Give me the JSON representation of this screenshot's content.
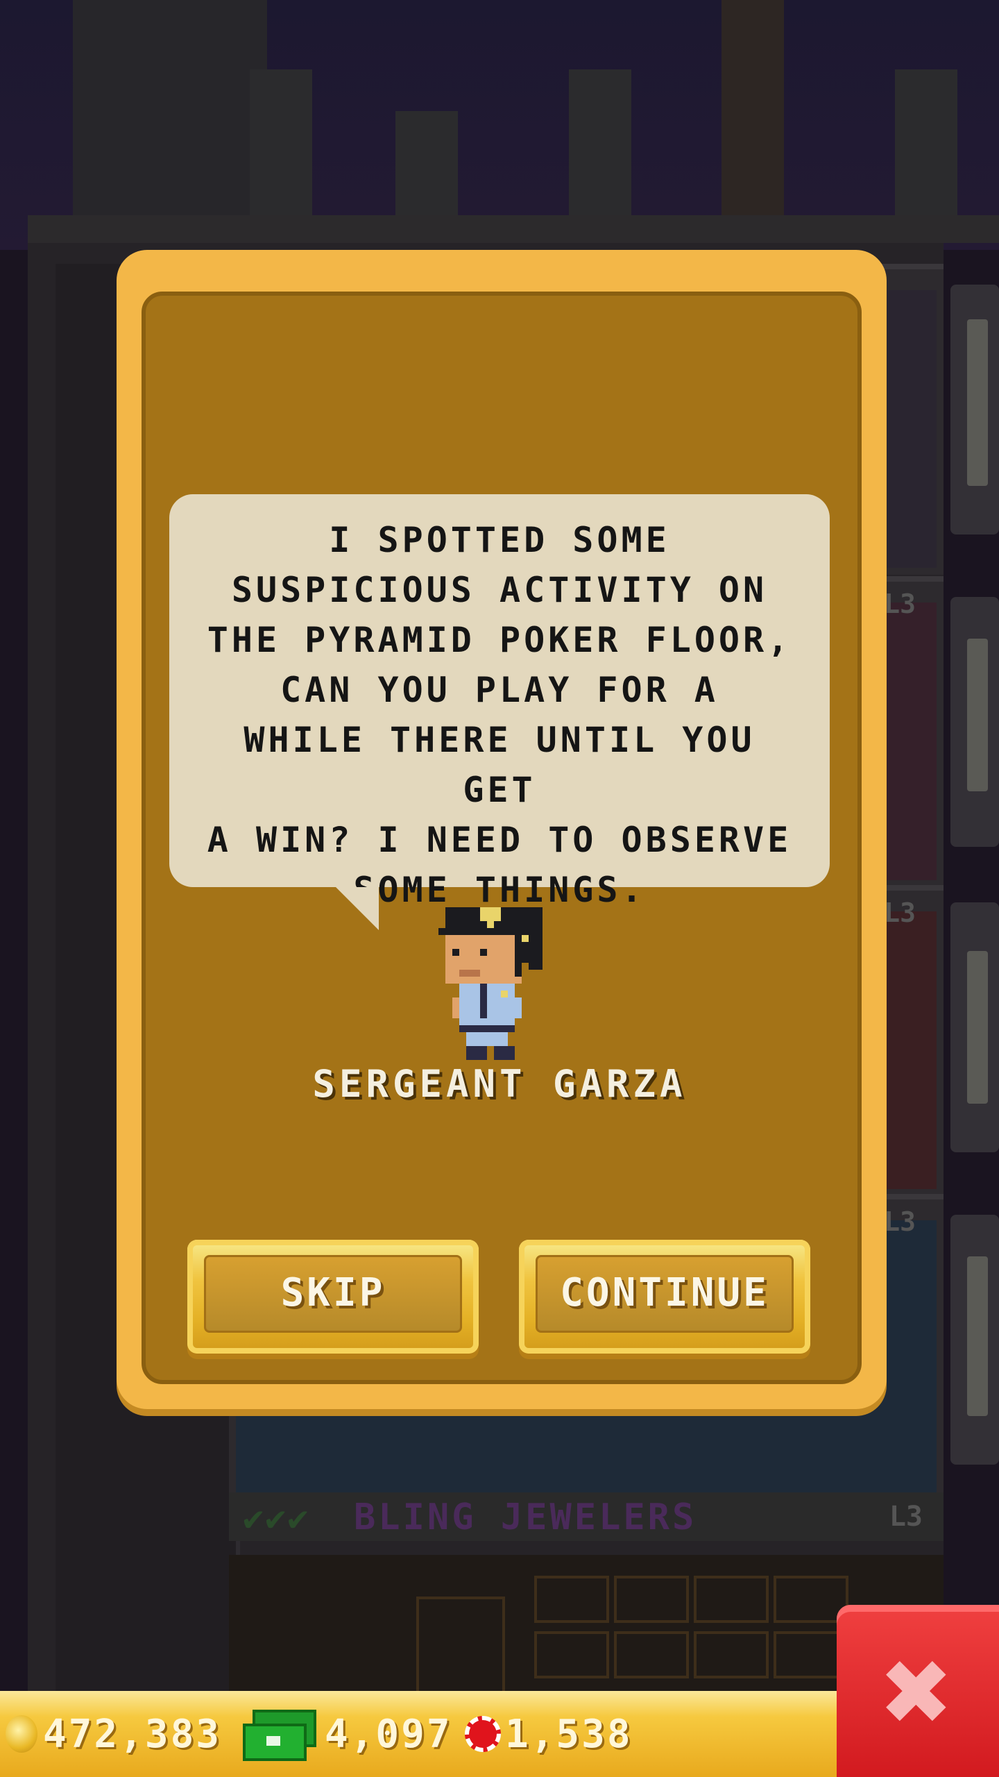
{
  "dialog": {
    "message": "I SPOTTED SOME\nSUSPICIOUS ACTIVITY ON\nTHE PYRAMID POKER FLOOR,\nCAN YOU PLAY FOR A\nWHILE THERE UNTIL YOU GET\nA WIN? I NEED TO OBSERVE\nSOME THINGS.",
    "speaker": "SERGEANT GARZA",
    "skip_label": "SKIP",
    "continue_label": "CONTINUE"
  },
  "background": {
    "floor_name": "BLING JEWELERS",
    "floor_level": "L3",
    "floor_checks": "✔✔✔"
  },
  "hud": {
    "coins": "472,383",
    "bux": "4,097",
    "chips": "1,538"
  },
  "icons": {
    "coin": "coin-icon",
    "bux": "cash-icon",
    "chips": "casino-chip-icon",
    "close": "close-icon"
  },
  "colors": {
    "dialog_frame": "#f3b748",
    "dialog_panel": "#a47317",
    "bubble": "#e3d8bd",
    "close_button": "#e02a2e"
  }
}
